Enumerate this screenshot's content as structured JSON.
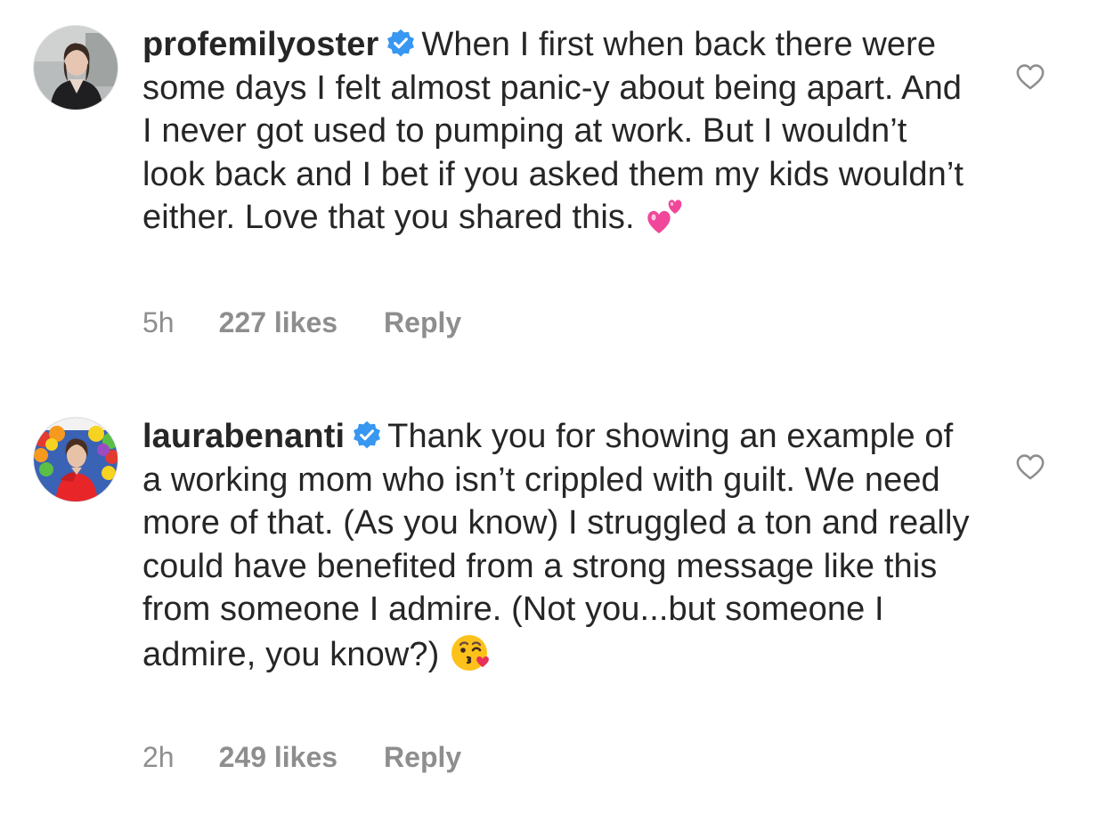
{
  "comments": [
    {
      "username": "profemilyoster",
      "text": "When I first when back there were some days I felt almost panic-y about being apart. And I never got used to pumping at work. But I wouldn’t look back and I bet if you asked them my kids wouldn’t either. Love that you shared this.",
      "emoji": "two-hearts-emoji",
      "time": "5h",
      "likes": "227 likes",
      "reply": "Reply",
      "verified_icon": "verified-badge-icon",
      "like_icon": "heart-outline-icon"
    },
    {
      "username": "laurabenanti",
      "text": "Thank you for showing an example of a working mom who isn’t crippled with guilt. We need more of that. (As you know) I struggled a ton and really could have benefited from a strong message like this from someone I admire. (Not you...but someone I admire, you know?)",
      "emoji": "face-blowing-kiss-emoji",
      "time": "2h",
      "likes": "249 likes",
      "reply": "Reply",
      "verified_icon": "verified-badge-icon",
      "like_icon": "heart-outline-icon"
    }
  ],
  "colors": {
    "text": "#262626",
    "meta": "#8e8e8e",
    "verified": "#3897f0",
    "heart_outline": "#8e8e8e"
  }
}
